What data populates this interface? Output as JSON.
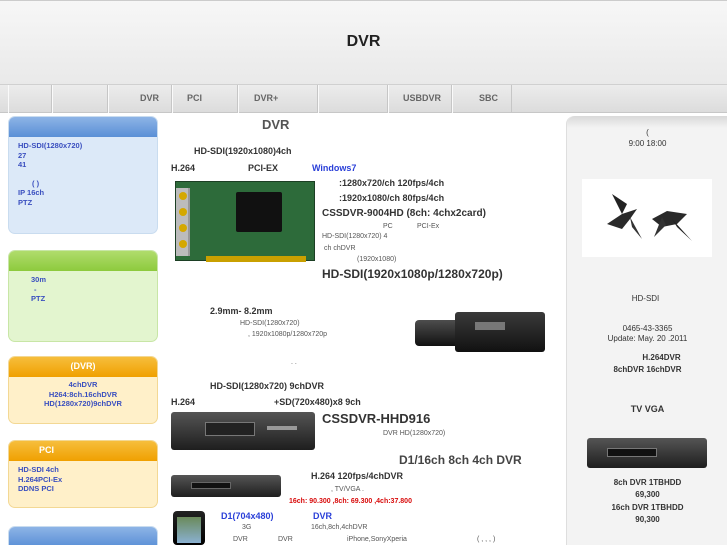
{
  "header": {
    "title": "DVR"
  },
  "nav": {
    "items": [
      "DVR",
      "PCI",
      "DVR+",
      "USBDVR",
      "SBC"
    ]
  },
  "left_boxes": [
    {
      "head": "",
      "lines": [
        "HD-SDI(1280x720)",
        "27",
        "41",
        "",
        "( )",
        "IP 16ch",
        "PTZ"
      ]
    },
    {
      "head": "",
      "lines": [
        "",
        "30m",
        "",
        "-",
        "PTZ"
      ]
    },
    {
      "head": "(DVR)",
      "lines": [
        "4chDVR",
        "H264:8ch.16chDVR",
        "HD(1280x720)9chDVR"
      ]
    },
    {
      "head": "PCI",
      "lines": [
        "HD-SDI 4ch",
        "H.264PCI-Ex",
        "DDNS PCI"
      ]
    },
    {
      "head": "",
      "lines": []
    }
  ],
  "center": {
    "heading": "DVR",
    "card": {
      "line1": "HD-SDI(1920x1080)4ch",
      "h264": "H.264",
      "pci": "PCI-EX",
      "os": "Windows7",
      "spec1": ":1280x720/ch 120fps/4ch",
      "spec2": ":1920x1080/ch 80fps/4ch",
      "model": "CSSDVR-9004HD (8ch: 4chx2card)",
      "pc": "PC",
      "pciex": "PCI-Ex",
      "desc1": "HD-SDI(1280x720) 4",
      "desc2": "ch chDVR",
      "desc3": "(1920x1080)",
      "big": "HD-SDI(1920x1080p/1280x720p)"
    },
    "camera": {
      "lens": "2.9mm- 8.2mm",
      "desc1": "HD-SDI(1280x720)",
      "desc2": ", 1920x1080p/1280x720p",
      "dots": ". ."
    },
    "hhd": {
      "line1": "HD-SDI(1280x720) 9chDVR",
      "h264": "H.264",
      "sd": "+SD(720x480)x8 9ch",
      "model": "CSSDVR-HHD916",
      "foot": "DVR HD(1280x720)"
    },
    "d1": {
      "title": "D1/16ch 8ch 4ch DVR",
      "spec": "H.264 120fps/4chDVR",
      "tv": ", TV/VGA .",
      "price": "16ch: 90.300 ,8ch: 69.300 ,4ch:37.800"
    },
    "mobile": {
      "title": "D1(704x480)",
      "dvr": "DVR",
      "g3": "3G",
      "ch": "16ch,8ch,4chDVR",
      "l1": "DVR",
      "l2": "DVR",
      "phones": "iPhone,SonyXperia",
      "paren": "( , , , )"
    }
  },
  "right": {
    "paren": "(",
    "hours": "9:00 18:00",
    "hdsdi": "HD-SDI",
    "phone": "0465-43-3365",
    "update": "Update: May. 20 .2011",
    "h264dvr": "H.264DVR",
    "links": "8chDVR 16chDVR",
    "tvvga": "TV VGA",
    "p1_name": "8ch DVR 1TBHDD",
    "p1_price": "69,300",
    "p2_name": "16ch DVR 1TBHDD",
    "p2_price": "90,300"
  },
  "colors": {
    "blue": "#2a3fd8",
    "red": "#d80a0a",
    "leftbox_blue": "#5a8fd6",
    "leftbox_green": "#8dca3d",
    "leftbox_orange": "#f0a000"
  }
}
